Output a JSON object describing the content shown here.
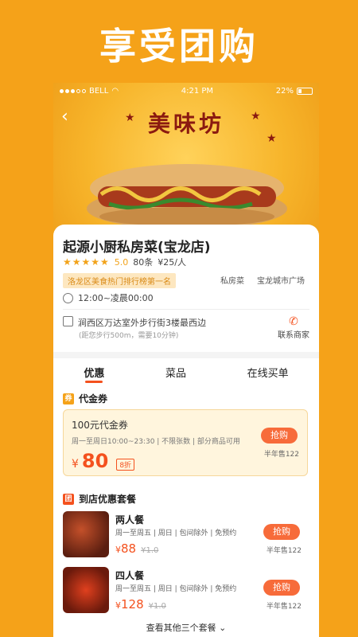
{
  "headline": "享受团购",
  "status_bar": {
    "carrier": "BELL",
    "time": "4:21 PM",
    "battery": "22%"
  },
  "hero": {
    "brand": "美味坊"
  },
  "shop": {
    "name": "起源小厨私房菜(宝龙店)",
    "score": "5.0",
    "reviews": "80条",
    "avg_price": "¥25/人",
    "rank_badge": "洛龙区美食热门排行榜第一名",
    "category": "私房菜",
    "area": "宝龙城市广场",
    "hours": "12:00~凌晨00:00",
    "address": "涧西区万达室外步行街3楼最西边",
    "distance_note": "(距您步行500m，需要10分钟)",
    "contact_label": "联系商家"
  },
  "tabs": [
    "优惠",
    "菜品",
    "在线买单"
  ],
  "voucher_section": {
    "title": "代金券",
    "voucher": {
      "title": "100元代金券",
      "desc": "周一至周日10:00~23:30 | 不限张数 | 部分商品可用",
      "currency": "¥",
      "price": "80",
      "discount": "8折",
      "buy": "抢购",
      "sold": "半年售122"
    }
  },
  "package_section": {
    "title": "到店优惠套餐",
    "icon_text": "团",
    "items": [
      {
        "name": "两人餐",
        "desc": "周一至周五 | 周日 | 包间除外 | 免预约",
        "currency": "¥",
        "price": "88",
        "old": "¥1.0",
        "buy": "抢购",
        "sold": "半年售122"
      },
      {
        "name": "四人餐",
        "desc": "周一至周五 | 周日 | 包间除外 | 免预约",
        "currency": "¥",
        "price": "128",
        "old": "¥1.0",
        "buy": "抢购",
        "sold": "半年售122"
      }
    ],
    "more": "查看其他三个套餐"
  }
}
